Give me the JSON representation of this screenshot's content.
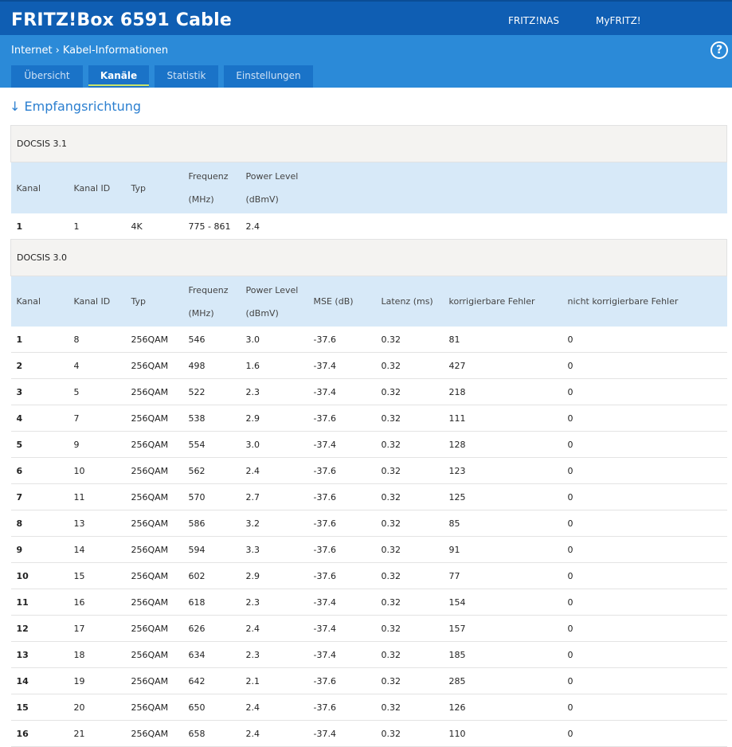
{
  "header": {
    "brand": "FRITZ!Box 6591 Cable",
    "links": [
      "FRITZ!NAS",
      "MyFRITZ!"
    ]
  },
  "breadcrumb": [
    "Internet",
    "Kabel-Informationen"
  ],
  "help_icon": "?",
  "tabs": [
    "Übersicht",
    "Kanäle",
    "Statistik",
    "Einstellungen"
  ],
  "active_tab": "Kanäle",
  "section": "↓ Empfangsrichtung",
  "docsis31": {
    "title": "DOCSIS 3.1",
    "headers": [
      "Kanal",
      "Kanal ID",
      "Typ",
      "Frequenz",
      "(MHz)",
      "Power Level",
      "(dBmV)"
    ],
    "rows": [
      [
        "1",
        "1",
        "4K",
        "775 - 861",
        "2.4"
      ]
    ]
  },
  "docsis30": {
    "title": "DOCSIS 3.0",
    "headers": [
      "Kanal",
      "Kanal ID",
      "Typ",
      "Frequenz",
      "(MHz)",
      "Power Level",
      "(dBmV)",
      "MSE (dB)",
      "Latenz (ms)",
      "korrigierbare Fehler",
      "nicht korrigierbare Fehler"
    ],
    "rows": [
      [
        "1",
        "8",
        "256QAM",
        "546",
        "3.0",
        "-37.6",
        "0.32",
        "81",
        "0"
      ],
      [
        "2",
        "4",
        "256QAM",
        "498",
        "1.6",
        "-37.4",
        "0.32",
        "427",
        "0"
      ],
      [
        "3",
        "5",
        "256QAM",
        "522",
        "2.3",
        "-37.4",
        "0.32",
        "218",
        "0"
      ],
      [
        "4",
        "7",
        "256QAM",
        "538",
        "2.9",
        "-37.6",
        "0.32",
        "111",
        "0"
      ],
      [
        "5",
        "9",
        "256QAM",
        "554",
        "3.0",
        "-37.4",
        "0.32",
        "128",
        "0"
      ],
      [
        "6",
        "10",
        "256QAM",
        "562",
        "2.4",
        "-37.6",
        "0.32",
        "123",
        "0"
      ],
      [
        "7",
        "11",
        "256QAM",
        "570",
        "2.7",
        "-37.6",
        "0.32",
        "125",
        "0"
      ],
      [
        "8",
        "13",
        "256QAM",
        "586",
        "3.2",
        "-37.6",
        "0.32",
        "85",
        "0"
      ],
      [
        "9",
        "14",
        "256QAM",
        "594",
        "3.3",
        "-37.6",
        "0.32",
        "91",
        "0"
      ],
      [
        "10",
        "15",
        "256QAM",
        "602",
        "2.9",
        "-37.6",
        "0.32",
        "77",
        "0"
      ],
      [
        "11",
        "16",
        "256QAM",
        "618",
        "2.3",
        "-37.4",
        "0.32",
        "154",
        "0"
      ],
      [
        "12",
        "17",
        "256QAM",
        "626",
        "2.4",
        "-37.4",
        "0.32",
        "157",
        "0"
      ],
      [
        "13",
        "18",
        "256QAM",
        "634",
        "2.3",
        "-37.4",
        "0.32",
        "185",
        "0"
      ],
      [
        "14",
        "19",
        "256QAM",
        "642",
        "2.1",
        "-37.6",
        "0.32",
        "285",
        "0"
      ],
      [
        "15",
        "20",
        "256QAM",
        "650",
        "2.4",
        "-37.6",
        "0.32",
        "126",
        "0"
      ],
      [
        "16",
        "21",
        "256QAM",
        "658",
        "2.4",
        "-37.4",
        "0.32",
        "110",
        "0"
      ]
    ]
  }
}
